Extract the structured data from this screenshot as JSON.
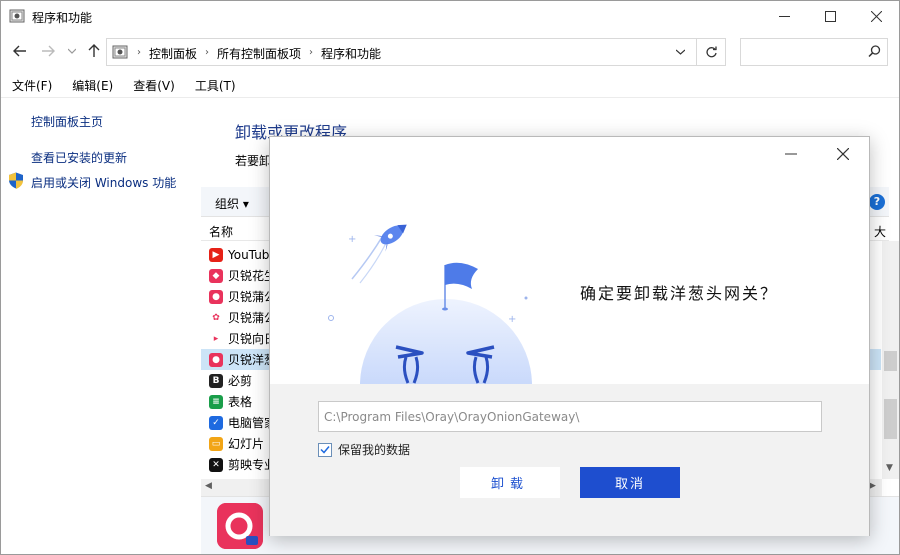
{
  "window": {
    "title": "程序和功能"
  },
  "nav": {
    "breadcrumbs": [
      "控制面板",
      "所有控制面板项",
      "程序和功能"
    ],
    "search_placeholder": ""
  },
  "menu": [
    "文件(F)",
    "编辑(E)",
    "查看(V)",
    "工具(T)"
  ],
  "left_pane": {
    "home": "控制面板主页",
    "updates": "查看已安装的更新",
    "features": "启用或关闭 Windows 功能"
  },
  "main": {
    "heading": "卸载或更改程序",
    "desc": "若要卸",
    "organize": "组织 ▾",
    "help": "?",
    "col_name": "名称",
    "col_size": "大",
    "programs": [
      {
        "name": "YouTube",
        "color": "#e62117",
        "glyph": "▶"
      },
      {
        "name": "贝锐花生",
        "color": "#e9335c",
        "glyph": "◆"
      },
      {
        "name": "贝锐蒲公",
        "color": "#e9335c",
        "glyph": "●"
      },
      {
        "name": "贝锐蒲公",
        "color": "#ffffff",
        "glyph": "✿"
      },
      {
        "name": "贝锐向日",
        "color": "#ffffff",
        "glyph": "▸"
      },
      {
        "name": "贝锐洋葱",
        "color": "#e9335c",
        "glyph": "●"
      },
      {
        "name": "必剪",
        "color": "#222222",
        "glyph": "B"
      },
      {
        "name": "表格",
        "color": "#1a9e4a",
        "glyph": "≡"
      },
      {
        "name": "电脑管家",
        "color": "#1e6ae0",
        "glyph": "✓"
      },
      {
        "name": "幻灯片",
        "color": "#f2a516",
        "glyph": "▭"
      },
      {
        "name": "剪映专业",
        "color": "#111111",
        "glyph": "✕"
      }
    ]
  },
  "dialog": {
    "question": "确定要卸载洋葱头网关？",
    "path": "C:\\Program Files\\Oray\\OrayOnionGateway\\",
    "keep_data": "保留我的数据",
    "uninstall": "卸载",
    "cancel": "取消"
  },
  "colors": {
    "accent": "#1e4ecf",
    "link": "#0a2e80",
    "heading": "#1e3b8c",
    "brand": "#e9335c"
  }
}
